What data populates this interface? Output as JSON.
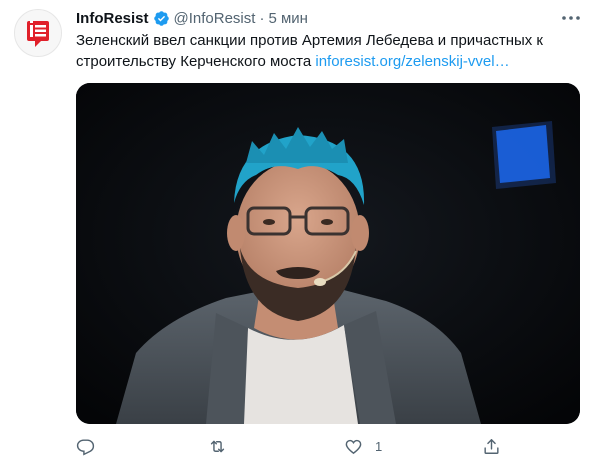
{
  "tweet": {
    "author_name": "InfoResist",
    "handle": "@InfoResist",
    "separator": "·",
    "time": "5 мин",
    "text": "Зеленский ввел санкции против Артемия Лебедева и причастных к строительству Керченского моста ",
    "link_text": "inforesist.org/zelenskij-vvel…",
    "icons": {
      "verified": "verified-badge-icon",
      "more": "more-options-icon",
      "reply": "reply-icon",
      "retweet": "retweet-icon",
      "like": "like-icon",
      "share": "share-icon"
    },
    "like_count": "1"
  },
  "colors": {
    "link": "#1d9bf0",
    "secondary_text": "#536471",
    "brand_red": "#e0202a",
    "verified_blue": "#1d9bf0"
  }
}
